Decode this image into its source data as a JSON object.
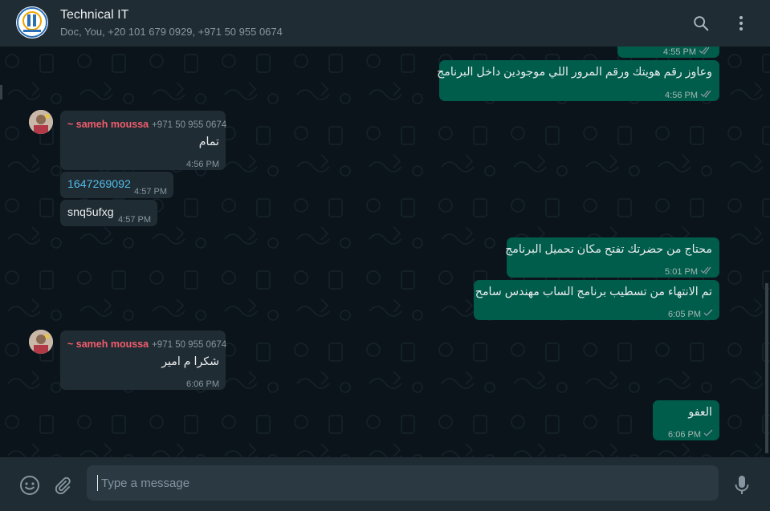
{
  "header": {
    "title": "Technical IT",
    "subtitle": "Doc, You, +20 101 679 0929, +971 50 955 0674",
    "search_icon": "search-icon",
    "menu_icon": "more-vertical-icon"
  },
  "colors": {
    "outgoing_bubble": "#005c4b",
    "incoming_bubble": "#202c33",
    "sender_name": "#f15c6d",
    "link": "#53bdeb",
    "read_ticks": "#8696a0"
  },
  "messages": [
    {
      "direction": "out",
      "time": "4:55 PM",
      "status": "read"
    },
    {
      "direction": "out",
      "text": "وعاوز رقم هويتك ورقم المرور اللي موجودين داخل البرنامج",
      "time": "4:56 PM",
      "status": "read"
    },
    {
      "direction": "in",
      "sender": "~ sameh moussa",
      "phone": "+971 50 955 0674",
      "text": "تمام",
      "time": "4:56 PM"
    },
    {
      "direction": "in",
      "text": "1647269092",
      "time": "4:57 PM"
    },
    {
      "direction": "in",
      "text": "snq5ufxg",
      "time": "4:57 PM"
    },
    {
      "direction": "out",
      "text": "محتاج من حضرتك تفتح مكان تحميل البرنامج",
      "time": "5:01 PM",
      "status": "read"
    },
    {
      "direction": "out",
      "text": "تم الانتهاء من تسطيب برنامج الساب مهندس سامح",
      "time": "6:05 PM",
      "status": "sent"
    },
    {
      "direction": "in",
      "sender": "~ sameh moussa",
      "phone": "+971 50 955 0674",
      "text": "شكرا م امير",
      "time": "6:06 PM"
    },
    {
      "direction": "out",
      "text": "العفو",
      "time": "6:06 PM",
      "status": "sent"
    }
  ],
  "footer": {
    "emoji_icon": "emoji-icon",
    "attach_icon": "paperclip-icon",
    "placeholder": "Type a message",
    "value": "",
    "mic_icon": "microphone-icon"
  }
}
